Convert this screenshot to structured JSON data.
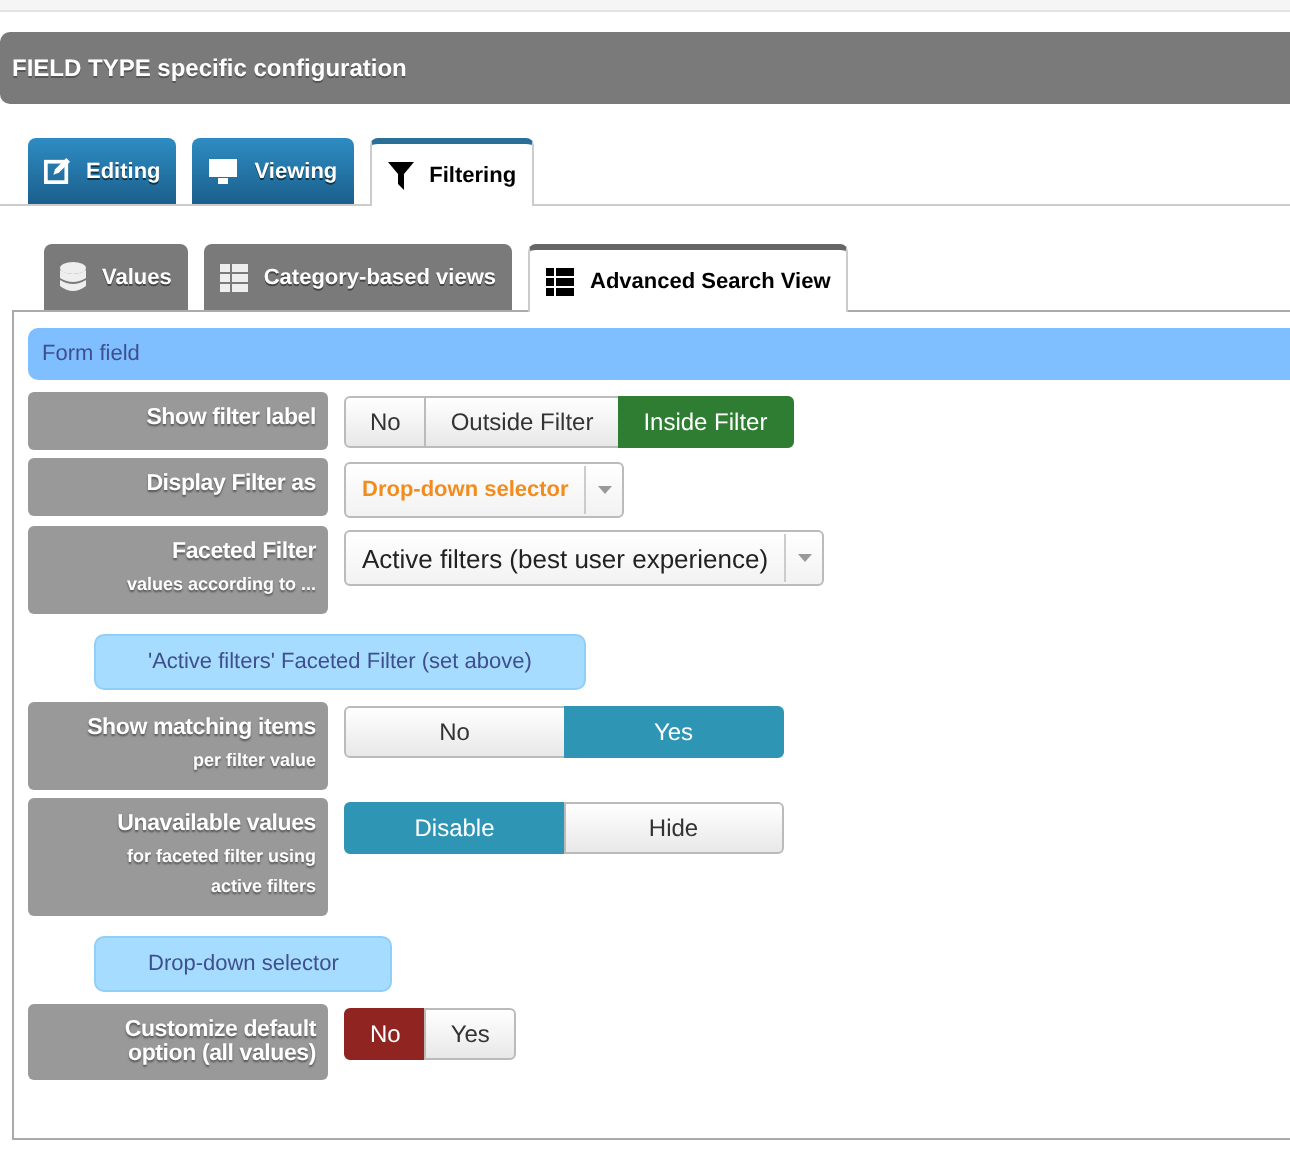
{
  "header": {
    "title": "FIELD TYPE specific configuration"
  },
  "tabs": [
    {
      "label": "Editing",
      "selected": false
    },
    {
      "label": "Viewing",
      "selected": false
    },
    {
      "label": "Filtering",
      "selected": true
    }
  ],
  "subtabs": [
    {
      "label": "Values",
      "selected": false
    },
    {
      "label": "Category-based views",
      "selected": false
    },
    {
      "label": "Advanced Search View",
      "selected": true
    }
  ],
  "rows": [
    {
      "kind": "section",
      "title": "Form field"
    },
    {
      "kind": "buttons",
      "label": "Show filter label",
      "options": [
        {
          "label": "No",
          "selected": false
        },
        {
          "label": "Outside Filter",
          "selected": false
        },
        {
          "label": "Inside Filter",
          "selected": true
        }
      ]
    },
    {
      "kind": "select",
      "label": "Display Filter as",
      "value": "Drop-down selector",
      "highlight": true
    },
    {
      "kind": "select",
      "label": "Faceted Filter",
      "sublabel": "values according to ...",
      "value": "Active filters (best user experience)",
      "highlight": false
    },
    {
      "kind": "subsection",
      "title": "'Active filters' Faceted Filter (set above)"
    },
    {
      "kind": "buttons",
      "label": "Show matching items",
      "sublabel": "per filter value",
      "options": [
        {
          "label": "No",
          "selected": false
        },
        {
          "label": "Yes",
          "selected": true
        }
      ]
    },
    {
      "kind": "buttons",
      "label": "Unavailable values",
      "sublabel": "for faceted filter using active filters",
      "options": [
        {
          "label": "Disable",
          "selected": true
        },
        {
          "label": "Hide",
          "selected": false
        }
      ]
    },
    {
      "kind": "subsection",
      "title": "Drop-down selector"
    },
    {
      "kind": "buttons",
      "label": "Customize default option (all values)",
      "options": [
        {
          "label": "No",
          "selected": true
        },
        {
          "label": "Yes",
          "selected": false
        }
      ]
    }
  ]
}
